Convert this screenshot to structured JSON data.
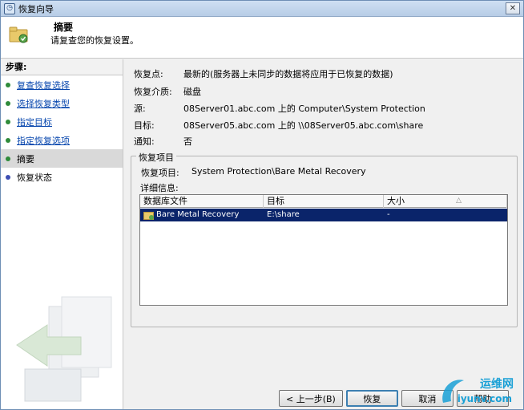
{
  "window": {
    "title": "恢复向导"
  },
  "header": {
    "title": "摘要",
    "subtitle": "请复查您的恢复设置。"
  },
  "nav": {
    "heading": "步骤:",
    "items": [
      {
        "label": "复查恢复选择",
        "state": "done"
      },
      {
        "label": "选择恢复类型",
        "state": "done"
      },
      {
        "label": "指定目标",
        "state": "done"
      },
      {
        "label": "指定恢复选项",
        "state": "done"
      },
      {
        "label": "摘要",
        "state": "current"
      },
      {
        "label": "恢复状态",
        "state": "pending"
      }
    ]
  },
  "summary": {
    "recovery_point_label": "恢复点:",
    "recovery_point_value": "最新的(服务器上未同步的数据将应用于已恢复的数据)",
    "media_label": "恢复介质:",
    "media_value": "磁盘",
    "source_label": "源:",
    "source_value": "08Server01.abc.com 上的 Computer\\System Protection",
    "target_label": "目标:",
    "target_value": "08Server05.abc.com 上的 \\\\08Server05.abc.com\\share",
    "notify_label": "通知:",
    "notify_value": "否"
  },
  "recovery_items": {
    "group_title": "恢复项目",
    "items_label": "恢复项目:",
    "items_value": "System Protection\\Bare Metal Recovery",
    "details_label": "详细信息:",
    "columns": [
      "数据库文件",
      "目标",
      "大小"
    ],
    "rows": [
      {
        "file": "Bare Metal Recovery",
        "target": "E:\\share",
        "size": "-"
      }
    ]
  },
  "buttons": {
    "back": "< 上一步(B)",
    "recover": "恢复",
    "cancel": "取消",
    "help": "帮助"
  },
  "watermark": {
    "line1": "运维网",
    "line2": "iyunv.com"
  },
  "colors": {
    "selected_row": "#0a246a",
    "link": "#0645ad",
    "step_done": "#2f8b3a",
    "step_pending": "#3e4fb3"
  }
}
